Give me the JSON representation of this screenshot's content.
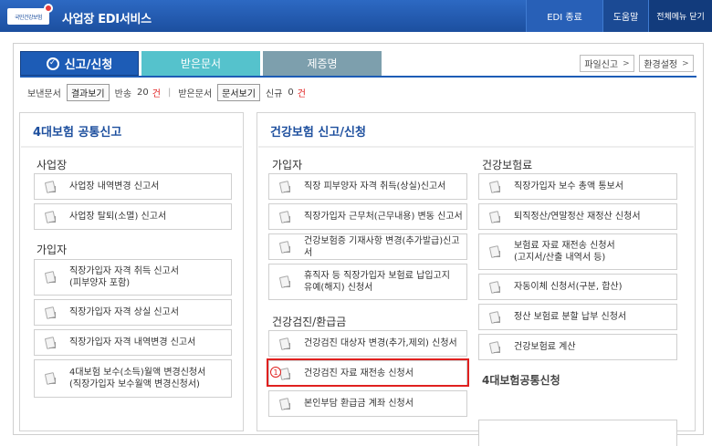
{
  "topbar": {
    "logo_text": "국민건강보험",
    "title": "사업장 EDI서비스",
    "edi_end": "EDI 종료",
    "help": "도움말",
    "close_all": "전체메뉴 닫기"
  },
  "tabs": [
    {
      "label": "신고/신청",
      "active": true
    },
    {
      "label": "받은문서",
      "active": false
    },
    {
      "label": "제증명",
      "active": false
    }
  ],
  "tools": {
    "file_report": "파일신고",
    "env_settings": "환경설정"
  },
  "status": {
    "sent_label": "보낸문서",
    "result_button": "결과보기",
    "return_label": "반송",
    "return_count": "20",
    "unit": "건",
    "received_label": "받은문서",
    "doc_button": "문서보기",
    "new_label": "신규",
    "new_count": "0"
  },
  "left_panel": {
    "title": "4대보험 공통신고",
    "section_workplace": "사업장",
    "workplace_items": [
      "사업장 내역변경 신고서",
      "사업장 탈퇴(소멸) 신고서"
    ],
    "section_subscriber": "가입자",
    "subscriber_items": [
      "직장가입자 자격 취득 신고서\n(피부양자 포함)",
      "직장가입자 자격 상실 신고서",
      "직장가입자 자격 내역변경 신고서",
      "4대보험 보수(소득)월액 변경신청서\n(직장가입자 보수월액 변경신청서)"
    ]
  },
  "right_panel": {
    "title": "건강보험 신고/신청",
    "section_subscriber": "가입자",
    "subscriber_items": [
      "직장 피부양자 자격 취득(상실)신고서",
      "직장가입자 근무처(근무내용) 변동 신고서",
      "건강보험증 기재사항 변경(추가발급)신고서",
      "휴직자 등 직장가입자 보험료 납입고지\n유예(해지) 신청서"
    ],
    "section_checkup": "건강검진/환급금",
    "checkup_items": [
      "건강검진 대상자 변경(추가,제외) 신청서",
      "건강검진 자료 재전송 신청서",
      "본인부담 환급금 계좌 신청서"
    ],
    "section_premium": "건강보험료",
    "premium_items": [
      "직장가입자 보수 총액 통보서",
      "퇴직정산/연말정산 재정산 신청서",
      "보험료 자료 재전송 신청서\n(고지서/산출 내역서 등)",
      "자동이체 신청서(구분, 합산)",
      "정산 보험료 분할 납부 신청서",
      "건강보험료 계산"
    ],
    "section_common": "4대보험공통신청",
    "highlight_marker": "1"
  }
}
